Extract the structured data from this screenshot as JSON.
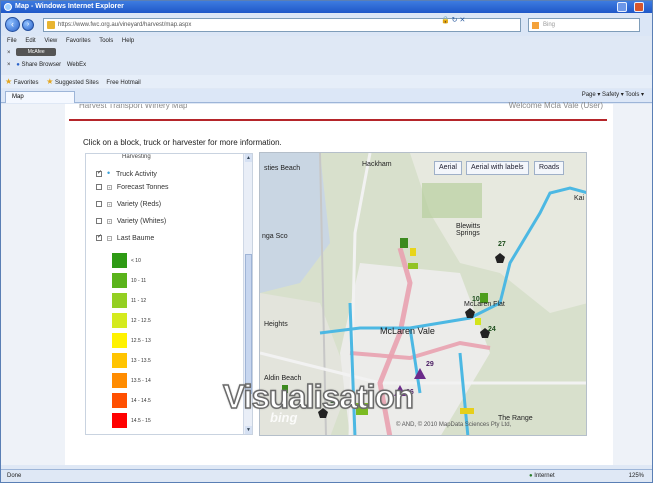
{
  "window": {
    "title": "Map - Windows Internet Explorer",
    "address": "https://www.fwc.org.au/vineyard/harvest/map.aspx",
    "search_placeholder": "Bing"
  },
  "menu": [
    "File",
    "Edit",
    "View",
    "Favorites",
    "Tools",
    "Help"
  ],
  "toolbar1": {
    "pill": "McAfee"
  },
  "toolbar2": {
    "label": "Share Browser",
    "widgets": "WebEx"
  },
  "favorites": {
    "label": "Favorites",
    "items": [
      "Suggested Sites",
      "Free Hotmail"
    ]
  },
  "tab": {
    "label": "Map"
  },
  "command_bar": "Page ▾  Safety ▾  Tools ▾",
  "page": {
    "nav_partial": "Harvest   Transport   Winery   Map",
    "nav_right": "Welcome Mcla Vale (User)",
    "hint": "Click on a block, truck or harvester for more information."
  },
  "legend": {
    "heading": "Harvesting",
    "rows": [
      {
        "label": "Truck Activity",
        "checked": true,
        "type": "dot"
      },
      {
        "label": "Forecast Tonnes",
        "checked": false,
        "type": "expand"
      },
      {
        "label": "Variety (Reds)",
        "checked": false,
        "type": "expand"
      },
      {
        "label": "Variety (Whites)",
        "checked": false,
        "type": "expand"
      },
      {
        "label": "Last Baume",
        "checked": true,
        "type": "expand"
      }
    ],
    "swatches": [
      {
        "label": "< 10",
        "color": "#2e9a14"
      },
      {
        "label": "10 - 11",
        "color": "#5ab31a"
      },
      {
        "label": "11 - 12",
        "color": "#94cf22"
      },
      {
        "label": "12 - 12.5",
        "color": "#d4ea1e"
      },
      {
        "label": "12.5 - 13",
        "color": "#fff200"
      },
      {
        "label": "13 - 13.5",
        "color": "#ffc400"
      },
      {
        "label": "13.5 - 14",
        "color": "#ff8c00"
      },
      {
        "label": "14 - 14.5",
        "color": "#ff4f00"
      },
      {
        "label": "14.5 - 15",
        "color": "#ff0000"
      }
    ]
  },
  "map": {
    "buttons": [
      "Aerial",
      "Aerial with labels",
      "Roads"
    ],
    "labels": {
      "beach": "sties Beach",
      "hackham": "Hackham",
      "blewitt": "Blewitts Springs",
      "mclaren": "McLaren Vale",
      "mclaren_flat": "McLaren Flat",
      "heights": "Heights",
      "nga": "nga Sco",
      "beach2": "Aldin Beach",
      "range": "The Range",
      "kangarilla": "Kai"
    },
    "numbers": [
      "27",
      "10",
      "24",
      "29",
      "26",
      "11"
    ],
    "copyright": "© AND, © 2010 MapData Sciences Pty Ltd,",
    "bing": "bing"
  },
  "overlay_text": "Visualisation",
  "status": {
    "left": "Done",
    "zone": "Internet",
    "zoom": "125%"
  }
}
